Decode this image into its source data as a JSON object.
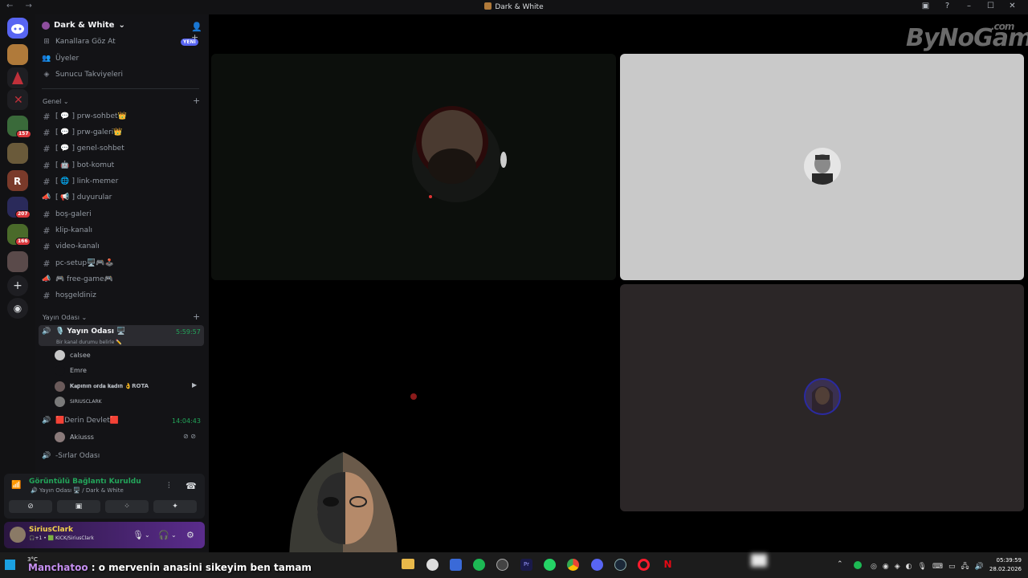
{
  "window": {
    "title": "Dark & White",
    "nav": "← →",
    "controls": [
      "▣",
      "?",
      "–",
      "☐",
      "✕"
    ]
  },
  "guilds": {
    "badges": [
      "157",
      "207",
      "166"
    ]
  },
  "server": {
    "name": "Dark & White",
    "top_items": [
      {
        "icon": "browse-channels-icon",
        "label": "Kanallara Göz At",
        "tag": "YENİ"
      },
      {
        "icon": "members-icon",
        "label": "Üyeler"
      },
      {
        "icon": "boost-icon",
        "label": "Sunucu Takviyeleri"
      }
    ],
    "categories": [
      {
        "name": "Genel",
        "channels": [
          {
            "type": "text",
            "label": "[ 💬 ] prw-sohbet👑"
          },
          {
            "type": "text",
            "label": "[ 💬 ] prw-galeri👑"
          },
          {
            "type": "text",
            "label": "[ 💬 ] genel-sohbet"
          },
          {
            "type": "text",
            "label": "[ 🤖 ] bot-komut"
          },
          {
            "type": "text",
            "label": "[ 🌐 ] link-memer"
          },
          {
            "type": "announce",
            "label": "[ 📢 ] duyurular"
          },
          {
            "type": "text",
            "label": "boş-galeri"
          },
          {
            "type": "text",
            "label": "klip-kanalı"
          },
          {
            "type": "text",
            "label": "video-kanalı"
          },
          {
            "type": "text",
            "label": "pc-setup🖥️🎮🕹️"
          },
          {
            "type": "announce",
            "label": "🎮 free-game🎮"
          },
          {
            "type": "text",
            "label": "hoşgeldiniz"
          }
        ]
      },
      {
        "name": "Yayın Odası",
        "voice": [
          {
            "label": "🎙️ Yayın Odası 🖥️",
            "status": "Bir kanal durumu belirle ✏️",
            "timer": "5:59:57",
            "members": [
              "caIsee",
              "Emre",
              "𝐊𝐚𝐩ı𝐧ı𝐧 𝐨𝐫𝐝𝐚 𝐤𝐚𝐝ı𝐧 👌ROTA",
              "SIRIUSCLARK"
            ]
          },
          {
            "label": "🟥Derin Devlet🟥",
            "timer": "14:04:43",
            "members": [
              "Akiusss"
            ]
          },
          {
            "label": "-Sırlar Odası"
          }
        ]
      }
    ]
  },
  "voice_panel": {
    "title": "Görüntülü Bağlantı Kuruldu",
    "subtitle": "🔊 Yayın Odası 🖥️ / Dark & White",
    "buttons": [
      "camera-off-icon",
      "screen-share-icon",
      "activities-icon",
      "soundboard-icon"
    ]
  },
  "user_panel": {
    "name": "SiriusClark",
    "status": "🎧+1 • 🟩 KICK/SiriusClark"
  },
  "watermark": {
    "text": "ByNoGame",
    "suffix": ".com"
  },
  "overlay_chat": {
    "user": "Manchatoo",
    "message": ": o mervenin anasini sikeyim ben tamam"
  },
  "taskbar": {
    "weather": "3°C",
    "time": "05:39:59",
    "date": "28.02.2026"
  },
  "colors": {
    "accent": "#5865f2",
    "online": "#23a55a",
    "panel_bg": "#131316"
  }
}
